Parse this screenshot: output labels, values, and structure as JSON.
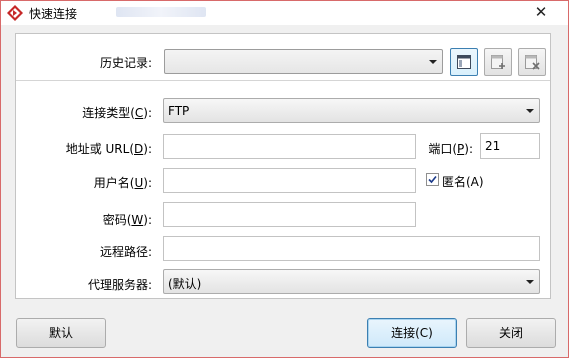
{
  "window": {
    "title": "快速连接",
    "close_glyph": "✕"
  },
  "history": {
    "label": "历史记录:",
    "value": ""
  },
  "connection_type": {
    "label_pre": "连接类型(",
    "label_key": "C",
    "label_post": "):",
    "value": "FTP"
  },
  "address": {
    "label_pre": "地址或 URL(",
    "label_key": "D",
    "label_post": "):",
    "value": ""
  },
  "port": {
    "label_pre": "端口(",
    "label_key": "P",
    "label_post": "):",
    "value": "21"
  },
  "username": {
    "label_pre": "用户名(",
    "label_key": "U",
    "label_post": "):",
    "value": ""
  },
  "anonymous": {
    "label": "匿名(A)",
    "checked": true
  },
  "password": {
    "label_pre": "密码(",
    "label_key": "W",
    "label_post": "):",
    "value": ""
  },
  "remote_path": {
    "label": "远程路径:",
    "value": ""
  },
  "proxy": {
    "label": "代理服务器:",
    "value": "(默认)"
  },
  "buttons": {
    "default": "默认",
    "connect": "连接(C)",
    "close": "关闭"
  },
  "colors": {
    "window_border": "#d86a6a",
    "accent": "#3c7fb1"
  },
  "icons": {
    "app": "app-logo-icon",
    "history_1": "window-layout-icon",
    "history_2": "add-entry-icon",
    "history_3": "delete-entry-icon"
  }
}
